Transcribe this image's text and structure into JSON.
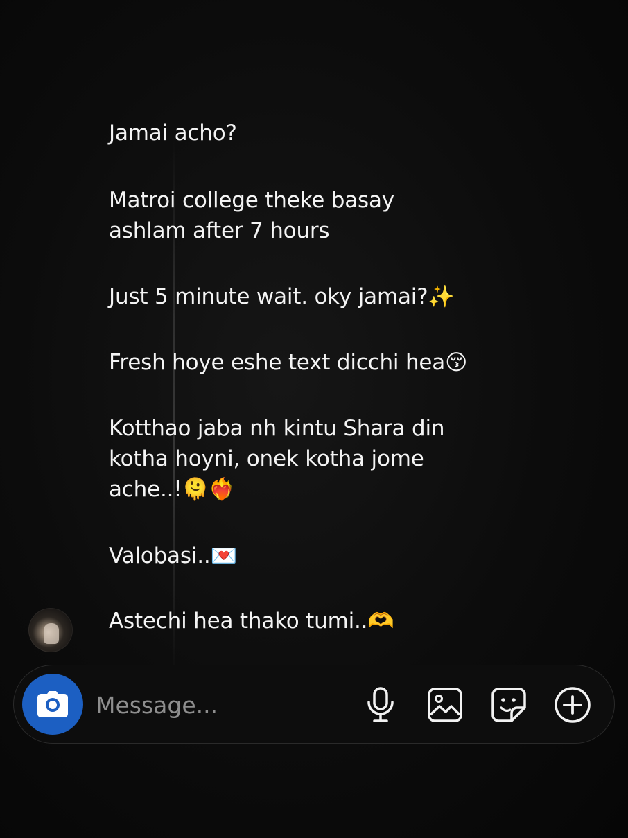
{
  "messages": [
    {
      "text": "Jamai acho?"
    },
    {
      "text": "Matroi college theke basay\nashlam after 7 hours"
    },
    {
      "text": "Just 5 minute wait. oky jamai?✨"
    },
    {
      "text": "Fresh hoye eshe text dicchi hea😚"
    },
    {
      "text": "Kotthao jaba nh kintu Shara din\nkotha hoyni, onek kotha jome\nache..!🫠❤️‍🔥"
    },
    {
      "text": "Valobasi..💌"
    },
    {
      "text": "Astechi hea thako tumi..🫶"
    }
  ],
  "composer": {
    "placeholder": "Message...",
    "value": "",
    "camera_button_color": "#1c5fc2",
    "icons": [
      "camera-icon",
      "microphone-icon",
      "gallery-icon",
      "sticker-icon",
      "plus-icon"
    ]
  },
  "colors": {
    "background": "#0a0a0a",
    "text": "#f4f4f4",
    "placeholder": "#8e8e8e",
    "composer_border": "#2a2a2a"
  }
}
